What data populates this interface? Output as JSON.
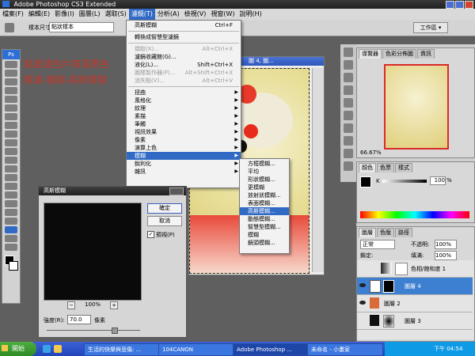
{
  "app": {
    "title": "Adobe Photoshop CS3 Extended"
  },
  "menubar": {
    "items": [
      "檔案(F)",
      "編輯(E)",
      "影像(I)",
      "圖層(L)",
      "選取(S)",
      "濾鏡(T)",
      "分析(A)",
      "檢視(V)",
      "視窗(W)",
      "說明(H)"
    ]
  },
  "options": {
    "brush_label": "樣本尺寸:",
    "brush_value": "點狀樣本",
    "workspace": "工作區 ▾"
  },
  "annotation": {
    "line1": "點選濾色片填滿黑色",
    "line2": "模濾-鏡糊-高斯模糊"
  },
  "document": {
    "title": "圖 4, 圖..."
  },
  "filter_menu": {
    "items": [
      {
        "label": "高斯模糊",
        "shortcut": "Ctrl+F"
      },
      {
        "sep": true
      },
      {
        "label": "轉換成智慧型濾鏡"
      },
      {
        "sep": true
      },
      {
        "label": "擷取(X)...",
        "shortcut": "Alt+Ctrl+X",
        "disabled": true
      },
      {
        "label": "濾鏡收藏館(G)..."
      },
      {
        "label": "液化(L)...",
        "shortcut": "Shift+Ctrl+X"
      },
      {
        "label": "圖樣製作器(P)...",
        "shortcut": "Alt+Shift+Ctrl+X",
        "disabled": true
      },
      {
        "label": "消失點(V)...",
        "shortcut": "Alt+Ctrl+V",
        "disabled": true
      },
      {
        "sep": true
      },
      {
        "label": "扭曲",
        "sub": true
      },
      {
        "label": "風格化",
        "sub": true
      },
      {
        "label": "紋理",
        "sub": true
      },
      {
        "label": "素描",
        "sub": true
      },
      {
        "label": "筆觸",
        "sub": true
      },
      {
        "label": "視訊效果",
        "sub": true
      },
      {
        "label": "像素",
        "sub": true
      },
      {
        "label": "演算上色",
        "sub": true
      },
      {
        "label": "模糊",
        "sub": true,
        "selected": true
      },
      {
        "label": "銳利化",
        "sub": true
      },
      {
        "label": "雜訊",
        "sub": true
      }
    ]
  },
  "blur_submenu": {
    "items": [
      "方框模糊...",
      "平均",
      "形狀模糊...",
      "更模糊",
      "放射狀模糊...",
      "表面模糊...",
      "高斯模糊...",
      "動態模糊...",
      "智慧型模糊...",
      "模糊",
      "鏡頭模糊..."
    ],
    "selected_index": 6
  },
  "dialog": {
    "title": "高斯模糊",
    "ok": "確定",
    "cancel": "取消",
    "preview": "預視(P)",
    "zoom": "100%",
    "radius_label": "強度(R):",
    "radius_value": "70.0",
    "radius_unit": "像素",
    "zoom_minus": "−",
    "zoom_plus": "+"
  },
  "navigator": {
    "tabs": [
      "導覽器",
      "色彩分佈圖",
      "資訊"
    ],
    "zoom": "66.67%"
  },
  "color_panel": {
    "tabs": [
      "顏色",
      "色票",
      "樣式"
    ],
    "k_label": "K",
    "k_value": "100",
    "k_unit": "%"
  },
  "layers_panel": {
    "tabs": [
      "圖層",
      "色版",
      "路徑"
    ],
    "mode": "正常",
    "opacity_label": "不透明:",
    "opacity": "100%",
    "lock_label": "鎖定:",
    "fill_label": "填滿:",
    "fill": "100%",
    "layers": [
      {
        "name": "色相/飽和度 1"
      },
      {
        "name": "圖層 4",
        "selected": true
      },
      {
        "name": "圖層 2"
      },
      {
        "name": "圖層 3"
      }
    ]
  },
  "taskbar": {
    "start": "開始",
    "tasks": [
      "生活的快樂與悲傷: ...",
      "104CANON",
      "Adobe Photoshop ...",
      "未命名 - 小畫家"
    ],
    "clock": "下午 04:54"
  },
  "colors": {
    "accent": "#316ac5",
    "annotation": "#c0392b"
  }
}
